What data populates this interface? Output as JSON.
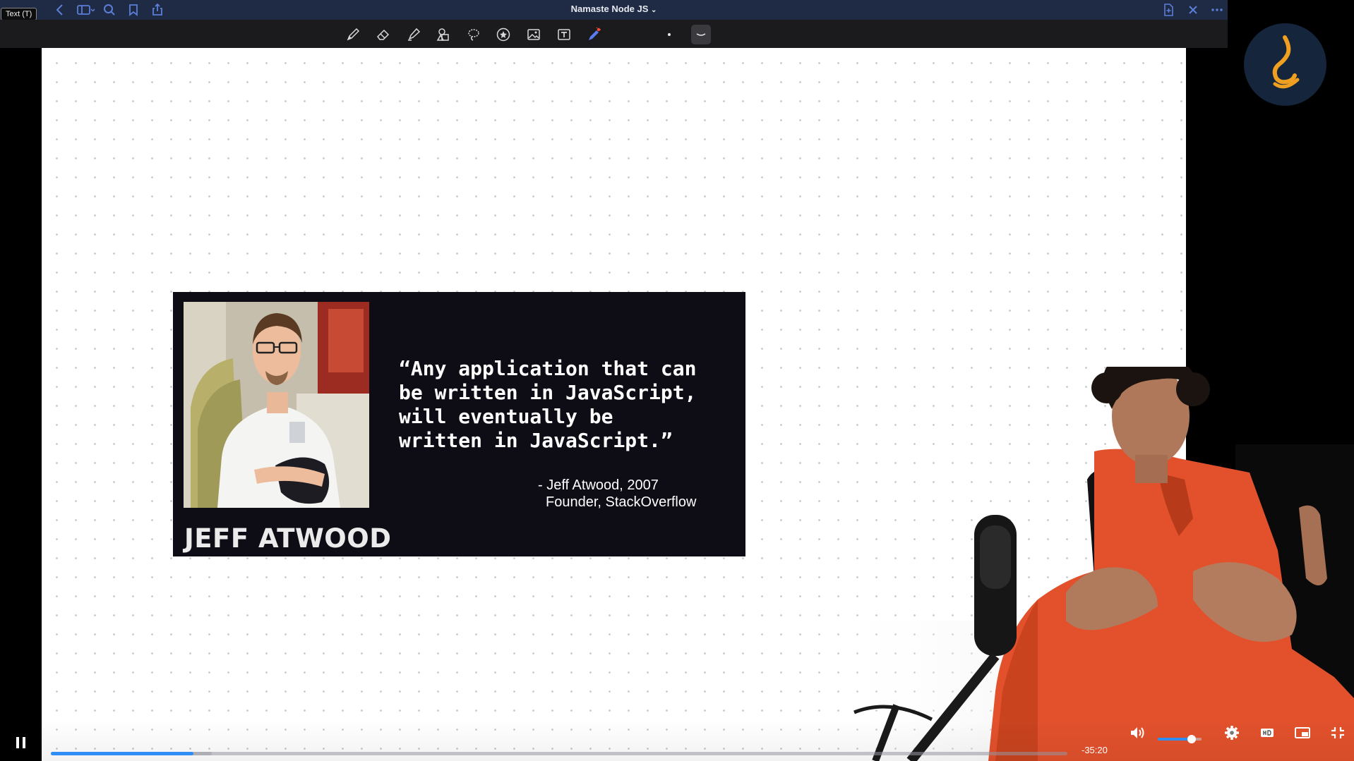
{
  "window": {
    "title": "Namaste Node JS",
    "title_chevron": "⌄",
    "tooltip": "Text (T)"
  },
  "toolbar": {
    "tools": [
      "pen-tool",
      "eraser-tool",
      "highlighter-tool",
      "shapes-tool",
      "lasso-tool",
      "sticker-tool",
      "image-tool",
      "text-tool",
      "laser-pointer-tool"
    ],
    "active_color": "#5b7cf0"
  },
  "slide": {
    "caption_name": "JEFF ATWOOD",
    "quote_lines": [
      "“Any application that can",
      "be written in JavaScript,",
      "will eventually be",
      "written in JavaScript.”"
    ],
    "attribution_line1": "- Jeff Atwood, 2007",
    "attribution_line2": "Founder, StackOverflow"
  },
  "player": {
    "time_remaining": "-35:20",
    "progress_fraction": 0.14,
    "buffered_fraction": 0.158,
    "volume_fraction": 0.78,
    "accent_color": "#2f8ef5"
  },
  "colors": {
    "topbar": "#1f2a44",
    "logo_bg": "#14253c",
    "logo_accent": "#f0a020",
    "card_bg": "#0e0c15"
  }
}
